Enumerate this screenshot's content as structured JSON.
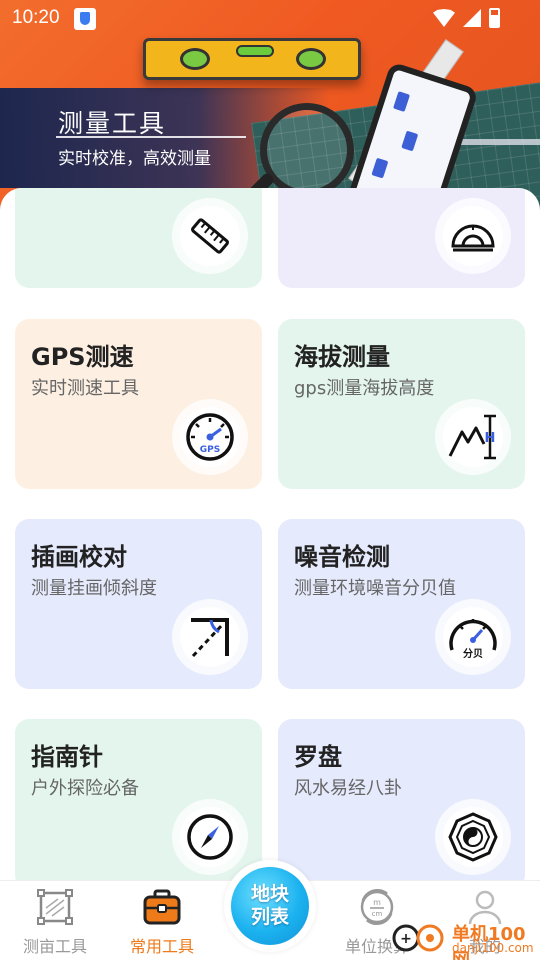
{
  "status_bar": {
    "time": "10:20"
  },
  "banner": {
    "title": "测量工具",
    "subtitle": "实时校准，高效测量"
  },
  "cards": [
    {
      "id": "ruler",
      "title": "",
      "subtitle": "",
      "icon": "ruler-icon",
      "color": "#e4f5ee"
    },
    {
      "id": "protractor",
      "title": "",
      "subtitle": "",
      "icon": "protractor-icon",
      "color": "#eeebfb"
    },
    {
      "id": "gps-speed",
      "title": "GPS测速",
      "subtitle": "实时测速工具",
      "icon": "speedometer-gps-icon",
      "icon_text": "GPS",
      "color": "#fdf0e2"
    },
    {
      "id": "altitude",
      "title": "海拔测量",
      "subtitle": "gps测量海拔高度",
      "icon": "mountain-altitude-icon",
      "color": "#e4f5ee"
    },
    {
      "id": "picture-level",
      "title": "插画校对",
      "subtitle": "测量挂画倾斜度",
      "icon": "frame-angle-icon",
      "color": "#e5eafc"
    },
    {
      "id": "noise",
      "title": "噪音检测",
      "subtitle": "测量环境噪音分贝值",
      "icon": "decibel-meter-icon",
      "icon_text": "分贝",
      "color": "#e5eafc"
    },
    {
      "id": "compass",
      "title": "指南针",
      "subtitle": "户外探险必备",
      "icon": "compass-icon",
      "color": "#e4f5ee"
    },
    {
      "id": "luopan",
      "title": "罗盘",
      "subtitle": "风水易经八卦",
      "icon": "bagua-icon",
      "color": "#e5eafc"
    }
  ],
  "bottom_nav": {
    "items": [
      {
        "label": "测亩工具",
        "icon": "field-measure-icon",
        "active": false
      },
      {
        "label": "常用工具",
        "icon": "toolbox-icon",
        "active": true
      },
      {
        "label": "单位换算",
        "icon": "unit-convert-icon",
        "active": false
      },
      {
        "label": "我的",
        "icon": "profile-icon",
        "active": false
      }
    ],
    "center": {
      "line1": "地块",
      "line2": "列表"
    }
  },
  "watermark": {
    "name": "单机100网",
    "url": "danji100.com"
  },
  "colors": {
    "accent": "#ef7a1a",
    "banner": "#f05a22",
    "fab": "#1bb2ef"
  }
}
